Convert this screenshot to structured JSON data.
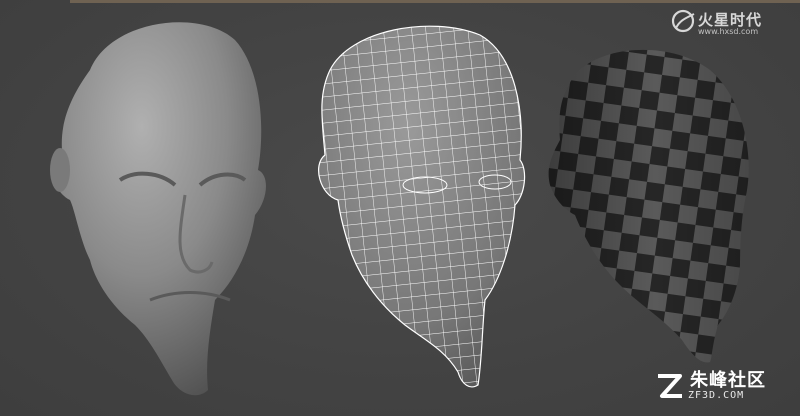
{
  "watermarks": {
    "top": {
      "brand": "火星时代",
      "url": "www.hxsd.com",
      "icon": "hxsd-logo-icon"
    },
    "bottom": {
      "brand": "朱峰社区",
      "url": "ZF3D.COM",
      "icon": "zf3d-logo-icon"
    }
  },
  "colors": {
    "background": "#444444",
    "shaded_head": "#8a8a8a",
    "wireframe_fill": "#7c7c7c",
    "wireframe_lines": "#ffffff",
    "checker_dark": "#262626",
    "checker_light": "#5a5a5a",
    "top_bar": "#6f6252"
  },
  "views": [
    {
      "name": "shaded"
    },
    {
      "name": "wireframe"
    },
    {
      "name": "checker-uv"
    }
  ]
}
